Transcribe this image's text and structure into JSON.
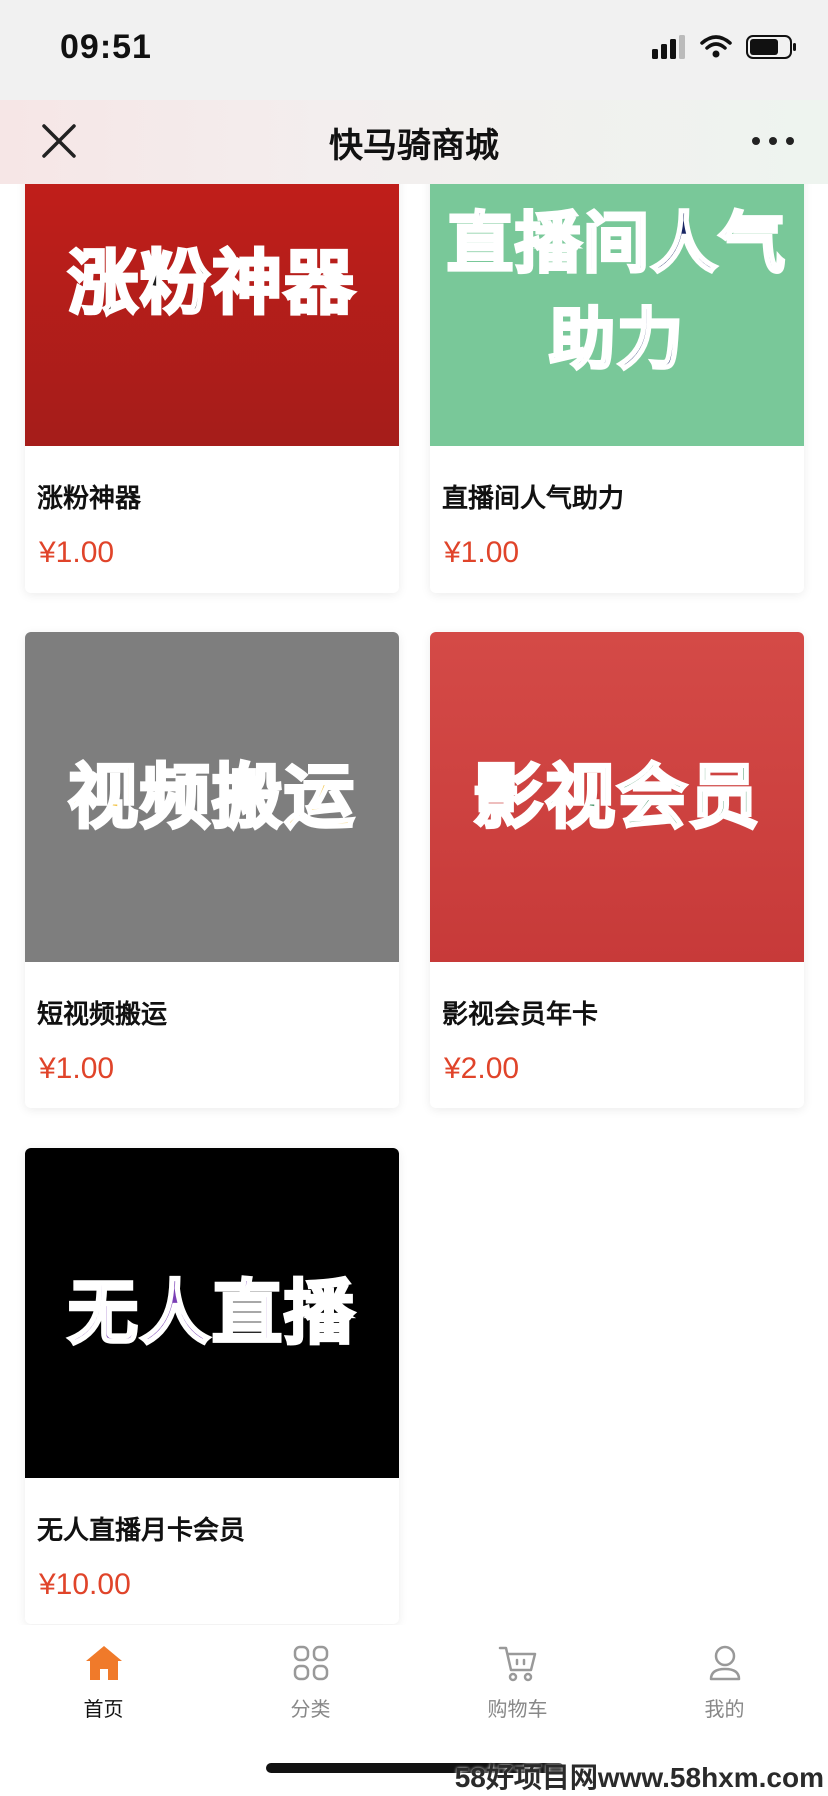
{
  "status_bar": {
    "time": "09:51"
  },
  "nav": {
    "title": "快马骑商城"
  },
  "products": [
    {
      "cover_text": "涨粉神器",
      "cover_bg": "#b8201c",
      "cover_fg": "#222222",
      "name": "涨粉神器",
      "price": "¥1.00"
    },
    {
      "cover_text": "直播间人气助力",
      "cover_bg": "#7ac89a",
      "cover_fg": "#1c2a6a",
      "name": "直播间人气助力",
      "price": "¥1.00"
    },
    {
      "cover_text": "视频搬运",
      "cover_bg": "#7d7d7d",
      "cover_fg": "#f2c84b",
      "name": "短视频搬运",
      "price": "¥1.00"
    },
    {
      "cover_text": "影视会员",
      "cover_bg": "#cf4040",
      "cover_fg": "#4e9c72",
      "name": "影视会员年卡",
      "price": "¥2.00"
    },
    {
      "cover_text": "无人直播",
      "cover_bg": "#000000",
      "cover_fg": "#7a3fb3",
      "name": "无人直播月卡会员",
      "price": "¥10.00"
    }
  ],
  "tabbar": {
    "items": [
      {
        "label": "首页",
        "icon": "home-icon",
        "active": true
      },
      {
        "label": "分类",
        "icon": "category-icon",
        "active": false
      },
      {
        "label": "购物车",
        "icon": "cart-icon",
        "active": false
      },
      {
        "label": "我的",
        "icon": "profile-icon",
        "active": false
      }
    ],
    "active_color": "#f07a2a",
    "inactive_color": "#999999"
  },
  "watermark": "58好项目网www.58hxm.com"
}
